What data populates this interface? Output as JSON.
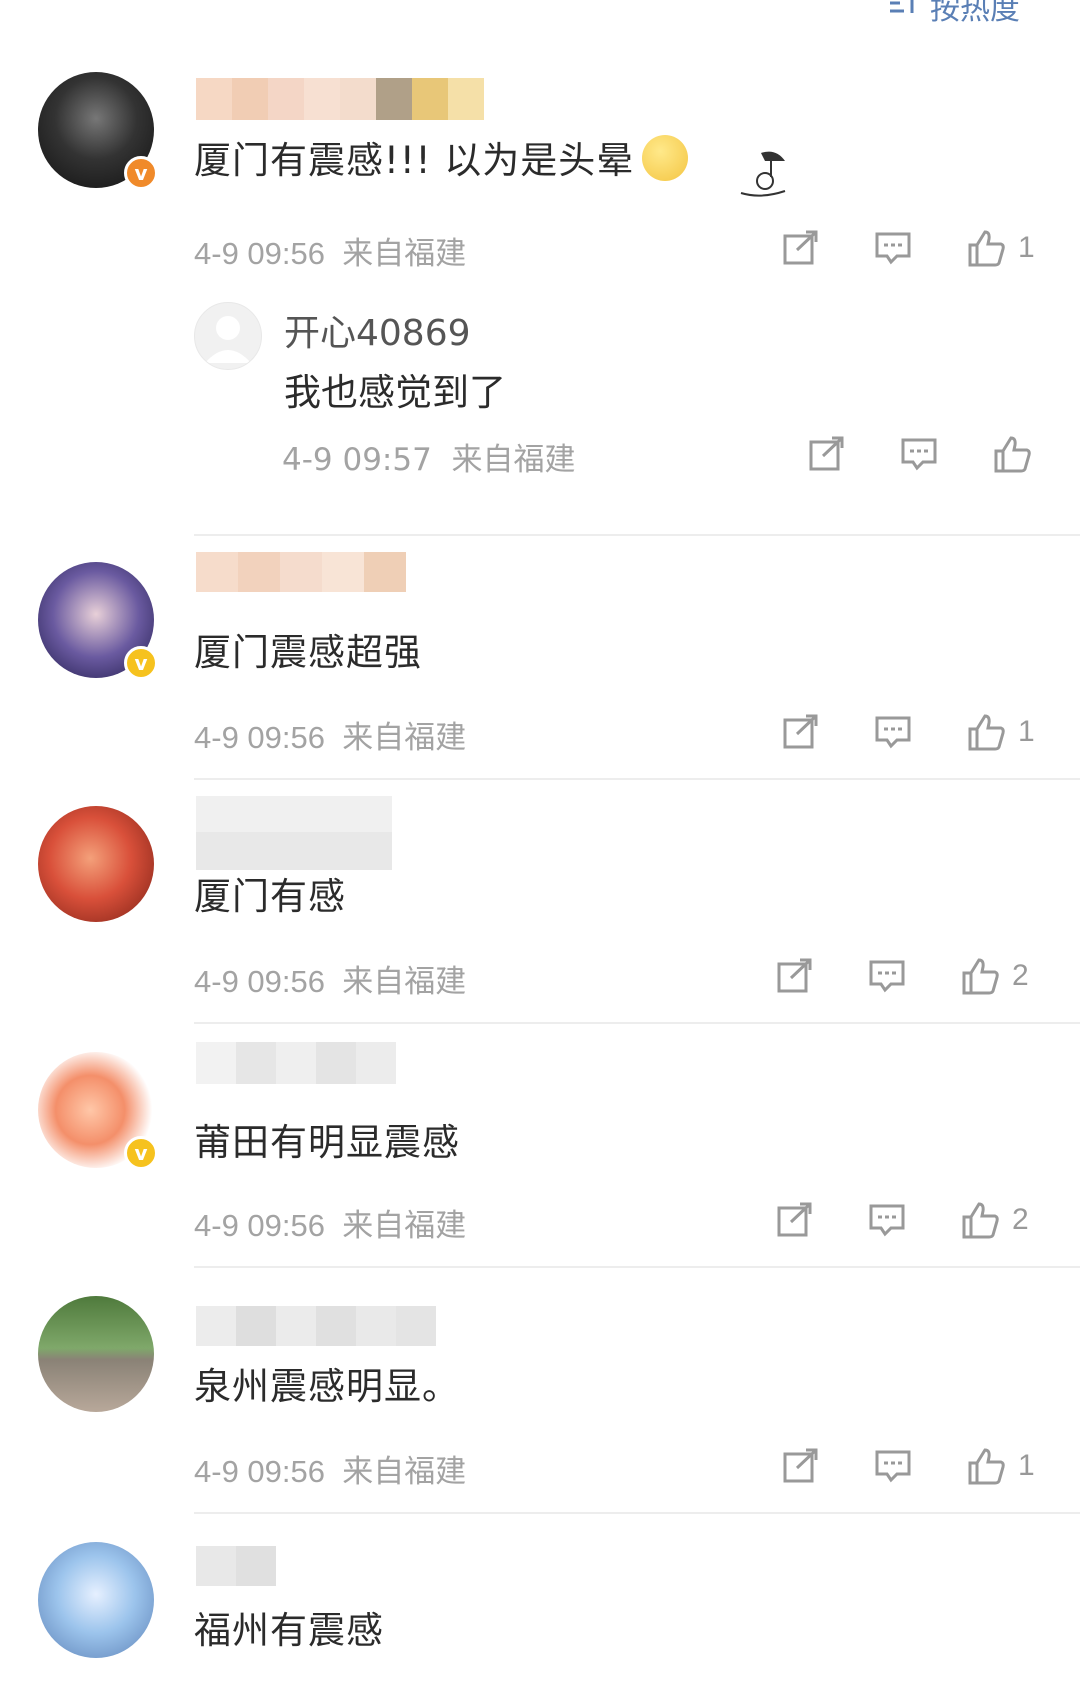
{
  "sort": {
    "label": "按热度"
  },
  "comments": [
    {
      "text": "厦门有震感!!! 以为是头晕",
      "time": "4-9 09:56",
      "location": "来自福建",
      "likes": "1",
      "badge": "orange"
    },
    {
      "text": "厦门震感超强",
      "time": "4-9 09:56",
      "location": "来自福建",
      "likes": "1",
      "badge": "gold"
    },
    {
      "text": "厦门有感",
      "time": "4-9 09:56",
      "location": "来自福建",
      "likes": "2",
      "badge": ""
    },
    {
      "text": "莆田有明显震感",
      "time": "4-9 09:56",
      "location": "来自福建",
      "likes": "2",
      "badge": "gold"
    },
    {
      "text": "泉州震感明显。",
      "time": "4-9 09:56",
      "location": "来自福建",
      "likes": "1",
      "badge": ""
    },
    {
      "text": "福州有震感",
      "time": "",
      "location": "",
      "likes": "",
      "badge": ""
    }
  ],
  "reply": {
    "name": "开心40869",
    "text": "我也感觉到了",
    "time": "4-9 09:57",
    "location": "来自福建"
  },
  "colors": {
    "accent": "#5a7fb5",
    "meta": "#a3a3a3",
    "badge_orange": "#f08a2a",
    "badge_gold": "#f6c21e"
  }
}
